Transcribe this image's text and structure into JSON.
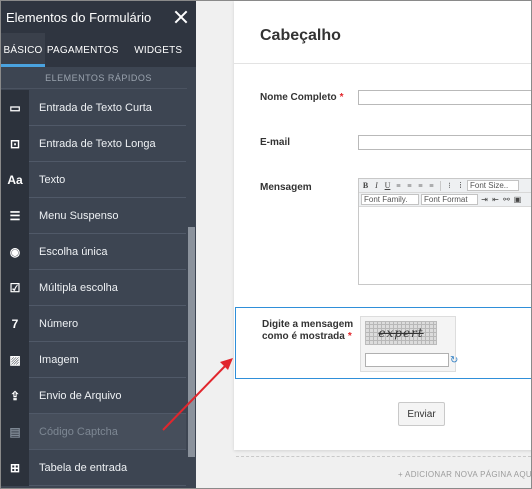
{
  "sidebar": {
    "title": "Elementos do Formulário",
    "tabs": [
      {
        "label": "BÁSICO",
        "active": true
      },
      {
        "label": "PAGAMENTOS",
        "active": false
      },
      {
        "label": "WIDGETS",
        "active": false
      }
    ],
    "section_label": "ELEMENTOS RÁPIDOS",
    "items": [
      {
        "label": "Entrada de Texto Curta",
        "icon": "short-text-icon",
        "glyph": "▭"
      },
      {
        "label": "Entrada de Texto Longa",
        "icon": "long-text-icon",
        "glyph": "⊡"
      },
      {
        "label": "Texto",
        "icon": "text-icon",
        "glyph": "Aa"
      },
      {
        "label": "Menu Suspenso",
        "icon": "dropdown-icon",
        "glyph": "☰"
      },
      {
        "label": "Escolha única",
        "icon": "radio-icon",
        "glyph": "◉"
      },
      {
        "label": "Múltipla escolha",
        "icon": "checkbox-icon",
        "glyph": "☑"
      },
      {
        "label": "Número",
        "icon": "number-icon",
        "glyph": "7"
      },
      {
        "label": "Imagem",
        "icon": "image-icon",
        "glyph": "▨"
      },
      {
        "label": "Envio de Arquivo",
        "icon": "file-upload-icon",
        "glyph": "⇪"
      },
      {
        "label": "Código Captcha",
        "icon": "captcha-icon",
        "glyph": "▤",
        "disabled": true
      },
      {
        "label": "Tabela de entrada",
        "icon": "table-icon",
        "glyph": "⊞"
      }
    ]
  },
  "form": {
    "title": "Cabeçalho",
    "fields": {
      "name_label": "Nome Completo",
      "email_label": "E-mail",
      "message_label": "Mensagem"
    },
    "editor": {
      "font_size": "Font Size..",
      "font_family": "Font Family.",
      "font_format": "Font Format"
    },
    "captcha": {
      "label": "Digite a mensagem como é mostrada",
      "text": "expert"
    },
    "submit_label": "Enviar",
    "add_page": "+ ADICIONAR NOVA PÁGINA AQUI"
  },
  "colors": {
    "sidebar_bg": "#3d4552",
    "accent": "#4aa3e0",
    "required": "#e2262b",
    "arrow": "#e1262d",
    "captcha_border": "#2f8fd9"
  }
}
